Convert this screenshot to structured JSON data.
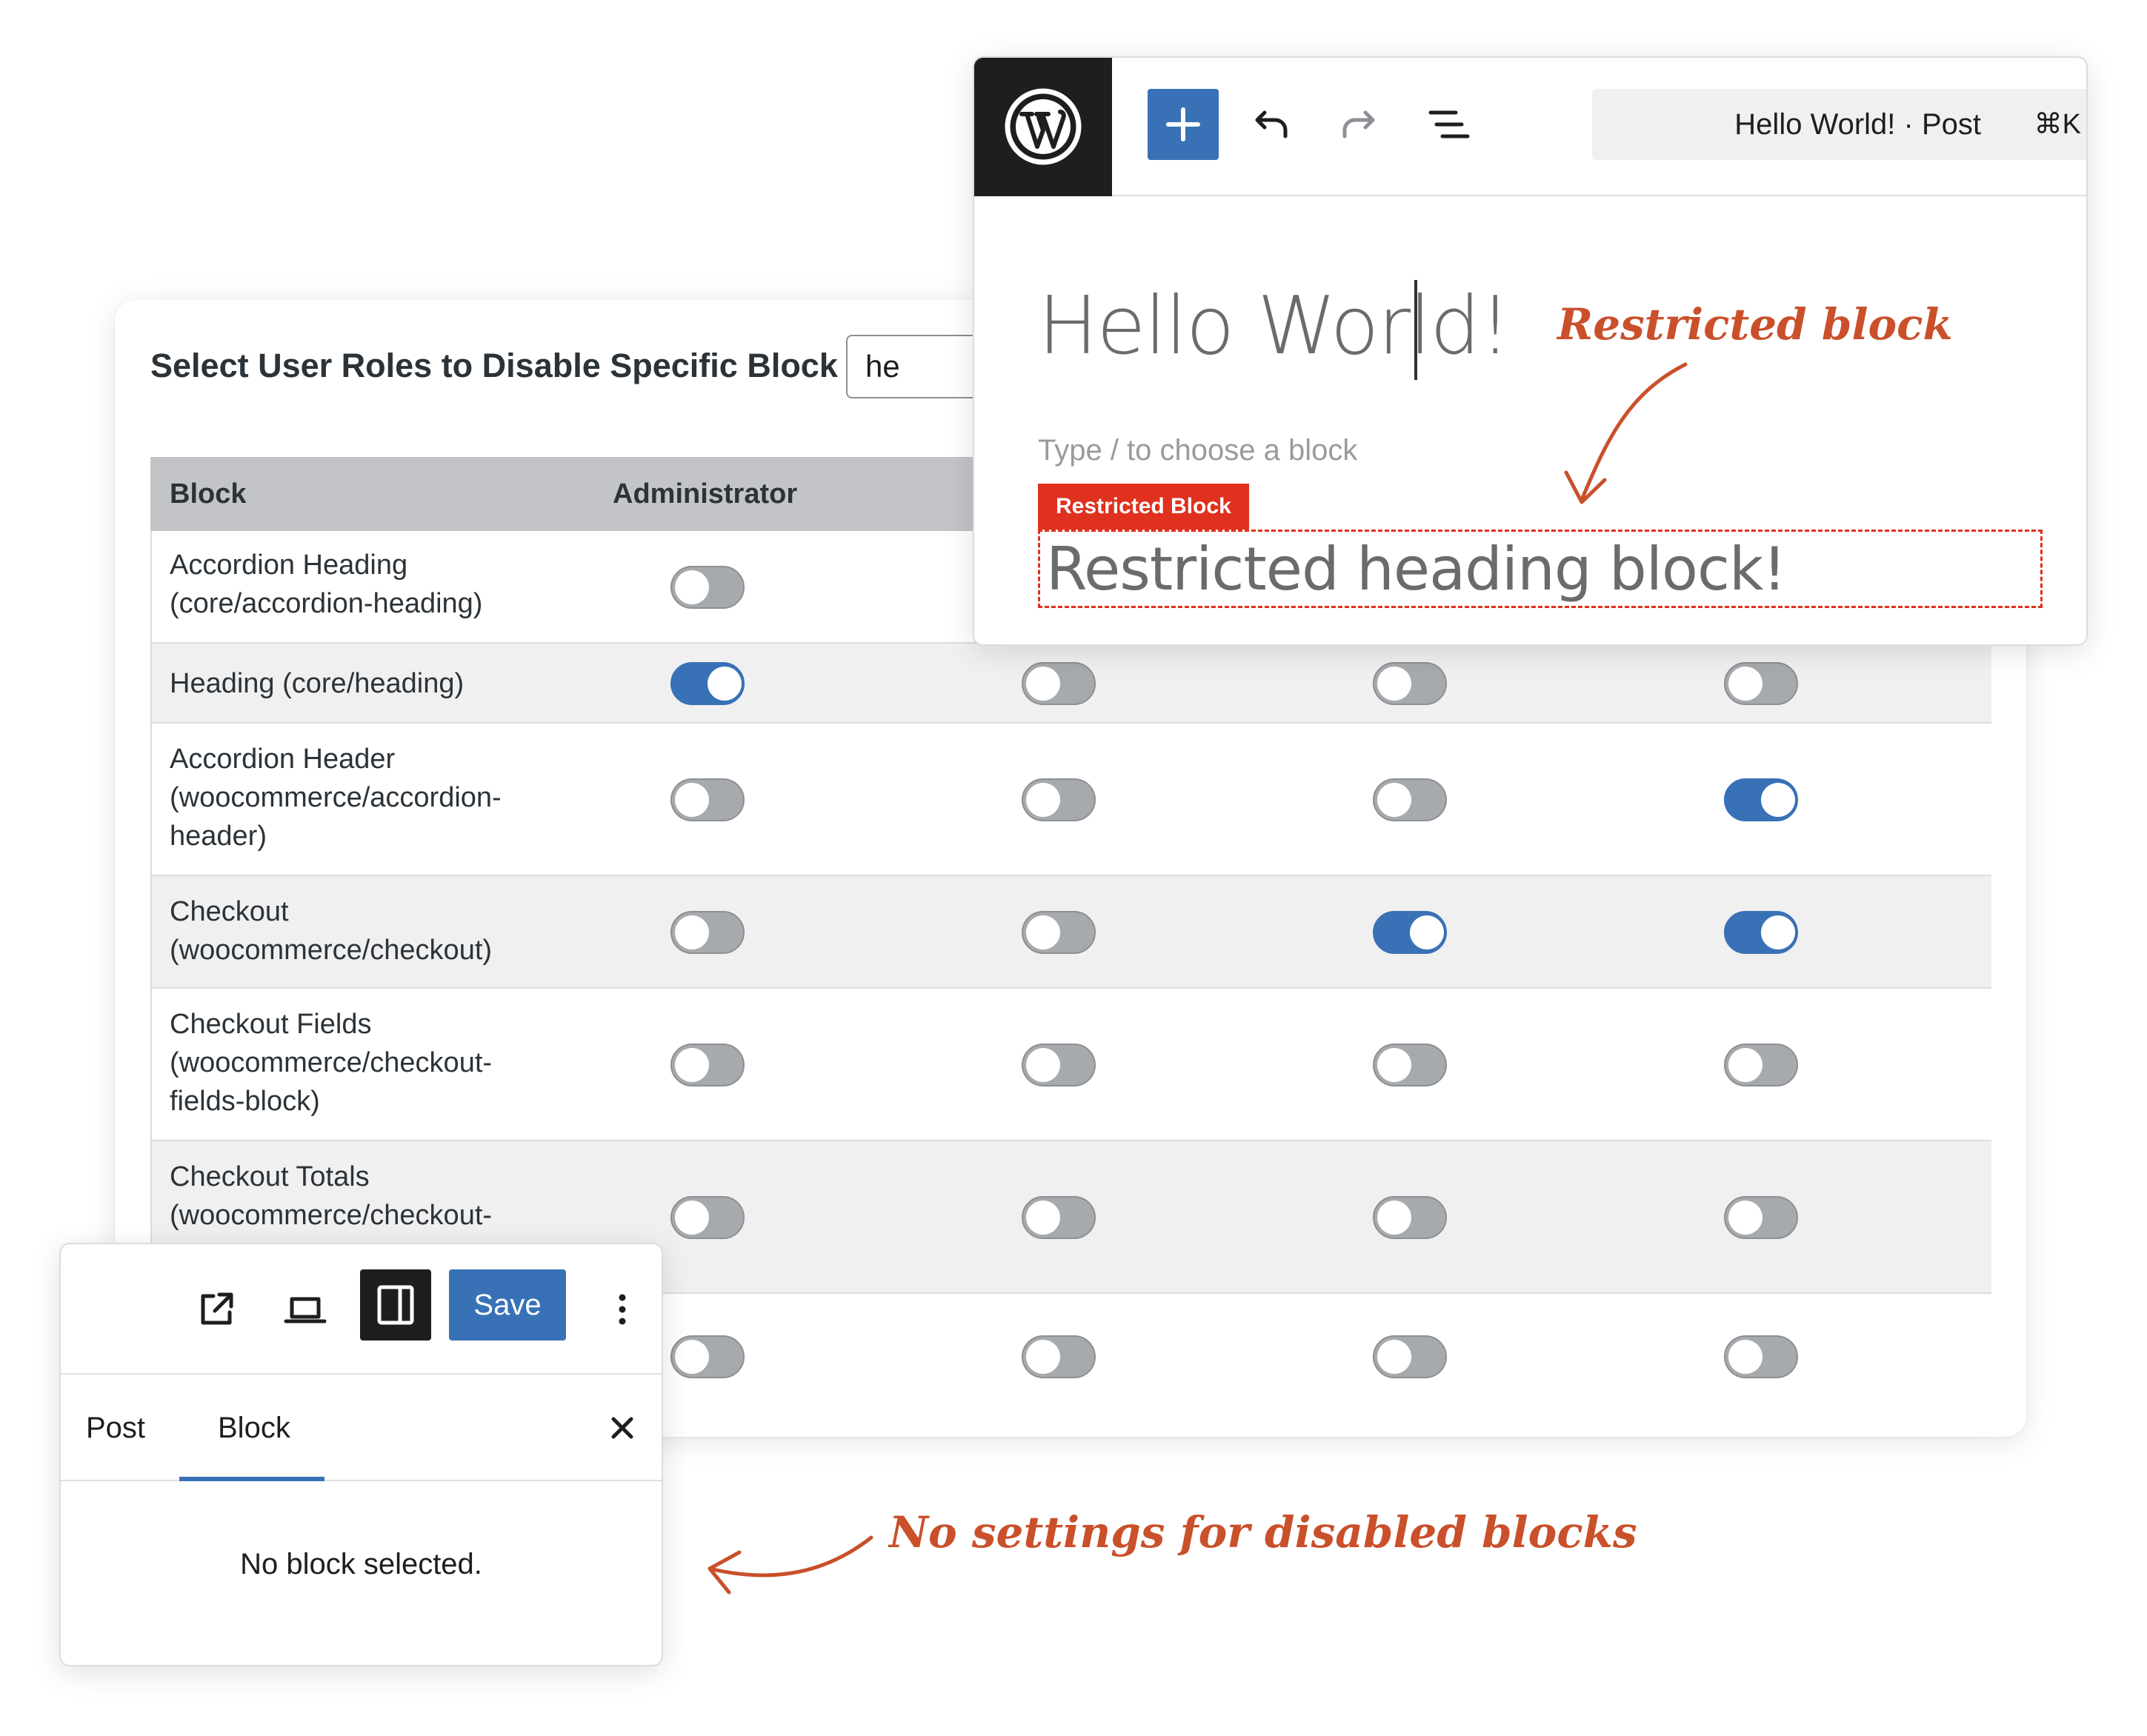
{
  "settings": {
    "title": "Select User Roles to Disable Specific Block",
    "search_value": "he",
    "columns": [
      "Block",
      "Administrator"
    ],
    "rows": [
      {
        "label": "Accordion Heading (core/accordion-heading)",
        "toggles": [
          false
        ]
      },
      {
        "label": "Heading (core/heading)",
        "toggles": [
          true,
          false,
          false,
          false
        ]
      },
      {
        "label": "Accordion Header (woocommerce/accordion-header)",
        "toggles": [
          false,
          false,
          false,
          true
        ]
      },
      {
        "label": "Checkout (woocommerce/checkout)",
        "toggles": [
          false,
          false,
          true,
          true
        ]
      },
      {
        "label": "Checkout Fields (woocommerce/checkout-fields-block)",
        "toggles": [
          false,
          false,
          false,
          false
        ]
      },
      {
        "label": "Checkout Totals (woocommerce/checkout-",
        "toggles": [
          false,
          false,
          false,
          false
        ]
      },
      {
        "label": "",
        "toggles": [
          false,
          false,
          false,
          false
        ]
      }
    ]
  },
  "editor": {
    "command_title": "Hello World! · Post",
    "command_shortcut": "⌘K",
    "post_title": "Hello World!",
    "placeholder": "Type / to choose a block",
    "restricted_badge": "Restricted Block",
    "restricted_text": "Restricted heading block!"
  },
  "panel": {
    "save_label": "Save",
    "tabs": [
      "Post",
      "Block"
    ],
    "active_tab": "Block",
    "empty_message": "No block selected."
  },
  "annotations": {
    "restricted": "Restricted block",
    "no_settings": "No settings for disabled blocks"
  },
  "colors": {
    "accent": "#3871b6",
    "restricted": "#e0301e",
    "annotation": "#c9502a"
  }
}
